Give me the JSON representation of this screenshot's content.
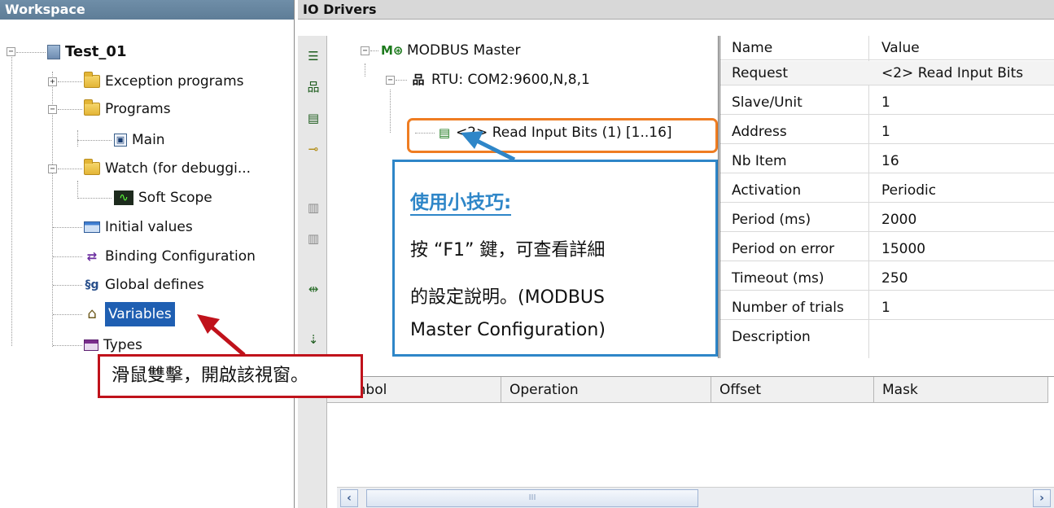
{
  "workspace": {
    "title": "Workspace",
    "project": "Test_01",
    "items": {
      "exception_programs": "Exception programs",
      "programs": "Programs",
      "main": "Main",
      "watch": "Watch (for debuggi...",
      "soft_scope": "Soft Scope",
      "initial_values": "Initial values",
      "binding_configuration": "Binding Configuration",
      "global_defines": "Global defines",
      "variables": "Variables",
      "types": "Types"
    }
  },
  "io_drivers": {
    "title": "IO Drivers",
    "tree": {
      "master": "MODBUS Master",
      "rtu": "RTU: COM2:9600,N,8,1",
      "request": "<2> Read Input Bits (1) [1..16]"
    },
    "properties": {
      "headers": {
        "name": "Name",
        "value": "Value"
      },
      "rows": [
        {
          "name": "Request",
          "value": "<2> Read Input Bits"
        },
        {
          "name": "Slave/Unit",
          "value": "1"
        },
        {
          "name": "Address",
          "value": "1"
        },
        {
          "name": "Nb Item",
          "value": "16"
        },
        {
          "name": "Activation",
          "value": "Periodic"
        },
        {
          "name": "Period (ms)",
          "value": "2000"
        },
        {
          "name": "Period on error",
          "value": "15000"
        },
        {
          "name": "Timeout (ms)",
          "value": "250"
        },
        {
          "name": "Number of trials",
          "value": "1"
        },
        {
          "name": "Description",
          "value": ""
        }
      ]
    },
    "table_headers": {
      "symbol": "Symbol",
      "operation": "Operation",
      "offset": "Offset",
      "mask": "Mask"
    },
    "scroll_thumb_grip": "III"
  },
  "callouts": {
    "tip_title": "使用小技巧:",
    "tip_line1": "按 “F1” 鍵，可查看詳細",
    "tip_line2": "的設定說明。(MODBUS",
    "tip_line3": "Master Configuration)",
    "double_click": "滑鼠雙擊，開啟該視窗。"
  },
  "colors": {
    "selection": "#1f5fb2",
    "tip_border": "#2e86c8",
    "highlight_border": "#ef7d22",
    "callout_border": "#c0121b"
  }
}
